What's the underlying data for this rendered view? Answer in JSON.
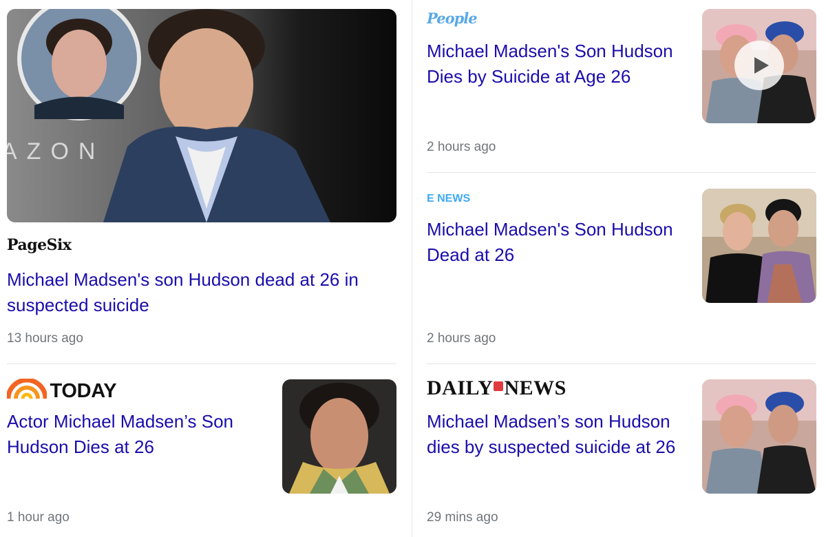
{
  "articles": [
    {
      "source": "PageSix",
      "headline": "Michael Madsen's son Hudson dead at 26 in suspected suicide",
      "time": "13 hours ago",
      "image_text": "AZON"
    },
    {
      "source": "TODAY",
      "headline": "Actor Michael Madsen’s Son Hudson Dies at 26",
      "time": "1 hour ago"
    },
    {
      "source": "People",
      "headline": "Michael Madsen's Son Hudson Dies by Suicide at Age 26",
      "time": "2 hours ago",
      "has_video": true
    },
    {
      "source": "E NEWS",
      "headline": "Michael Madsen's Son Hudson Dead at 26",
      "time": "2 hours ago"
    },
    {
      "source_parts": [
        "DAILY",
        "NEWS"
      ],
      "headline": "Michael Madsen’s son Hudson dies by suspected suicide at 26",
      "time": "29 mins ago"
    }
  ],
  "colors": {
    "headline": "#1a0dab",
    "timestamp": "#70757a",
    "today_brand": "#f26522",
    "people_brand": "#5aa9e6",
    "enews_brand": "#3fa9f5",
    "daily_news_mark": "#e03a3e"
  },
  "icons": {
    "video": "play-icon"
  }
}
